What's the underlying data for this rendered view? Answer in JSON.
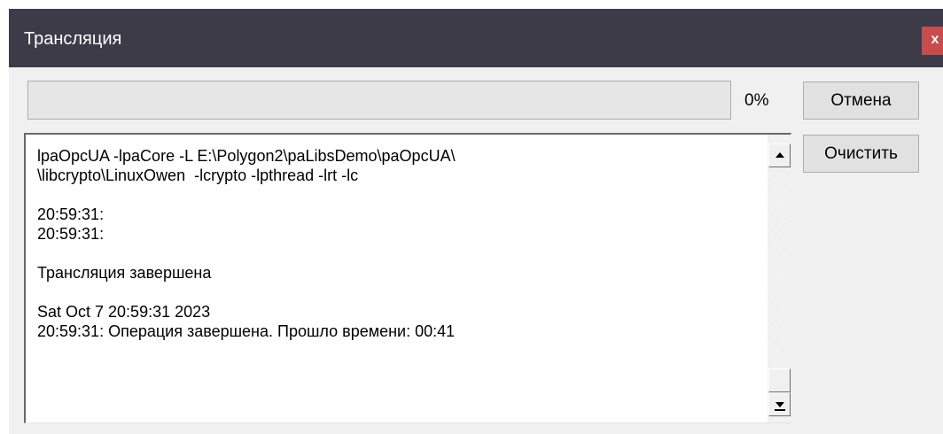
{
  "window": {
    "title": "Трансляция",
    "close_label": "x"
  },
  "progress": {
    "percent_text": "0%",
    "fraction": 0
  },
  "buttons": {
    "cancel_label": "Отмена",
    "clear_label": "Очистить"
  },
  "log": {
    "lines": [
      "lpaOpcUA -lpaCore -L E:\\Polygon2\\paLibsDemo\\paOpcUA\\",
      "\\libcrypto\\LinuxOwen  -lcrypto -lpthread -lrt -lc",
      "",
      "20:59:31:",
      "20:59:31:",
      "",
      "Трансляция завершена",
      "",
      "Sat Oct 7 20:59:31 2023",
      "20:59:31: Операция завершена. Прошло времени: 00:41"
    ]
  },
  "icons": {
    "scroll_up": "arrow-up-icon",
    "scroll_down": "arrow-down-icon",
    "close": "close-icon"
  },
  "colors": {
    "titlebar": "#3d3b47",
    "close_button": "#c94c4c",
    "window_bg": "#f0f0f0"
  }
}
